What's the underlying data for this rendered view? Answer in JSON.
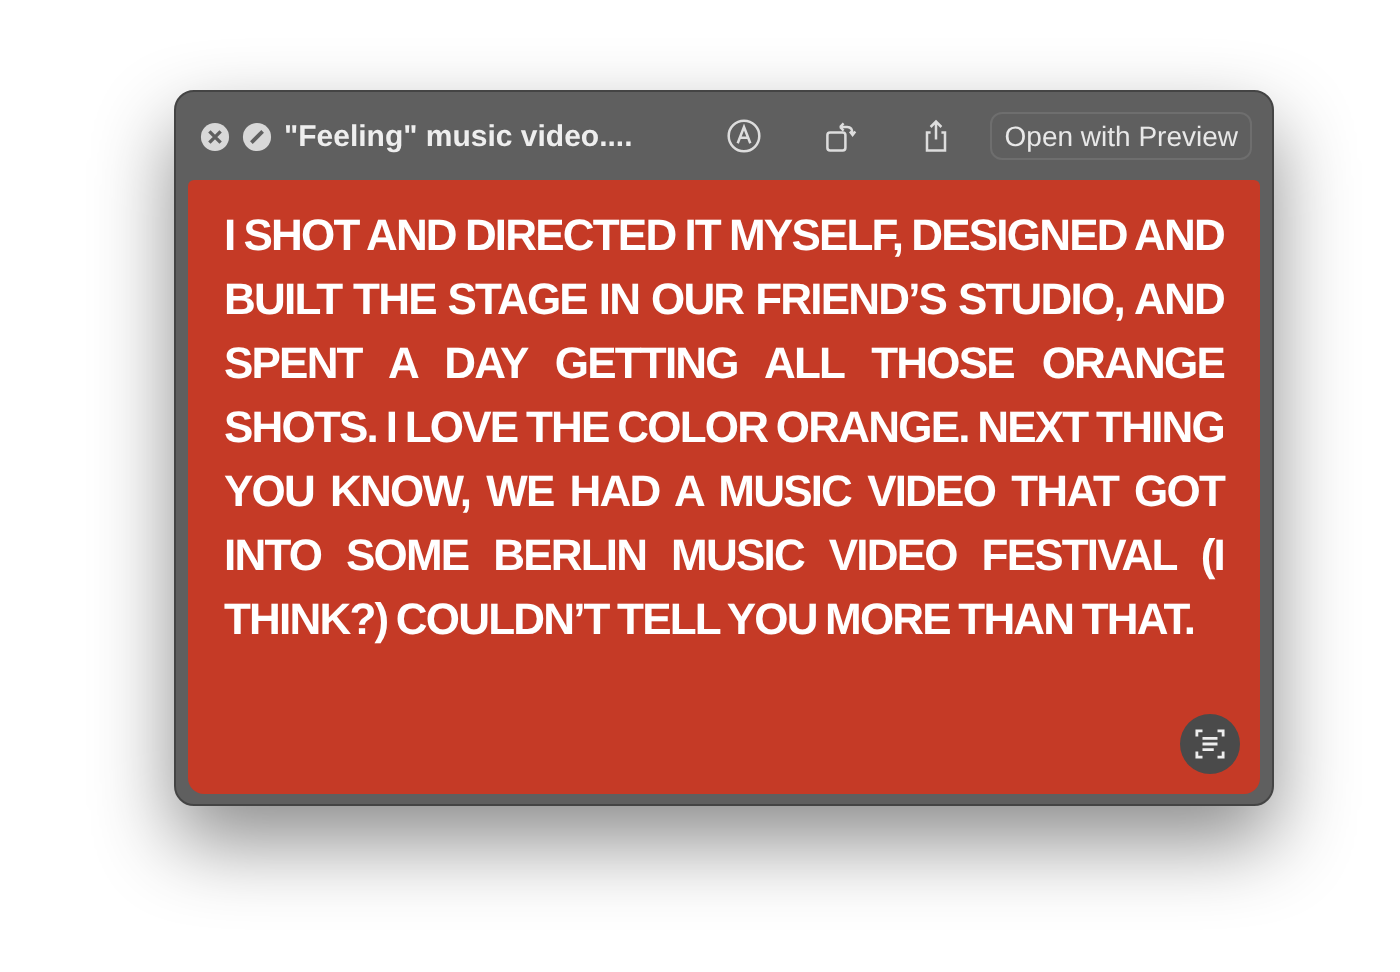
{
  "window": {
    "title": "\"Feeling\" music video....",
    "open_button": "Open with Preview"
  },
  "image": {
    "text": "I SHOT AND DIRECTED IT MYSELF, DESIGNED AND BUILT THE STAGE IN OUR FRIEND’S STUDIO, AND SPENT A DAY GETTING ALL THOSE ORANGE SHOTS. I LOVE THE COLOR ORANGE. NEXT THING YOU KNOW, WE HAD A MUSIC VIDEO THAT GOT INTO SOME BERLIN MUSIC VIDEO FESTIVAL (I THINK?) COULDN’T TELL YOU MORE THAN THAT."
  }
}
